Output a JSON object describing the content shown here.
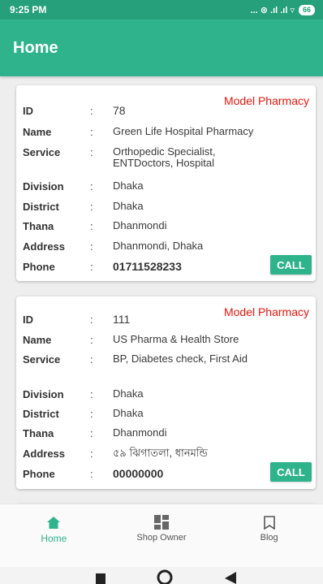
{
  "status_bar": {
    "time": "9:25 PM",
    "signal_indicators": "... ⊛ .ıl .ıl ▿",
    "battery": "66"
  },
  "app_bar": {
    "title": "Home"
  },
  "labels": {
    "id": "ID",
    "name": "Name",
    "service": "Service",
    "division": "Division",
    "district": "District",
    "thana": "Thana",
    "address": "Address",
    "phone": "Phone",
    "colon": ":"
  },
  "cards": [
    {
      "category": "Model Pharmacy",
      "id": "78",
      "name": "Green Life Hospital Pharmacy",
      "service": "Orthopedic Specialist, ENTDoctors, Hospital",
      "division": "Dhaka",
      "district": "Dhaka",
      "thana": "Dhanmondi",
      "address": "Dhanmondi, Dhaka",
      "phone": "01711528233",
      "call_label": "CALL"
    },
    {
      "category": "Model Pharmacy",
      "id": "111",
      "name": "US Pharma & Health Store",
      "service": "BP, Diabetes check, First Aid",
      "division": "Dhaka",
      "district": "Dhaka",
      "thana": "Dhanmondi",
      "address": "৫৯ ঝিগাতলা, ধানমন্ডি",
      "phone": "00000000",
      "call_label": "CALL"
    }
  ],
  "bottom_nav": {
    "items": [
      {
        "label": "Home",
        "icon": "home-icon",
        "active": true
      },
      {
        "label": "Shop Owner",
        "icon": "dashboard-icon",
        "active": false
      },
      {
        "label": "Blog",
        "icon": "bookmark-icon",
        "active": false
      }
    ]
  },
  "colors": {
    "primary": "#2fb38c",
    "status_bar": "#26a07a",
    "category_red": "#e8160c"
  }
}
